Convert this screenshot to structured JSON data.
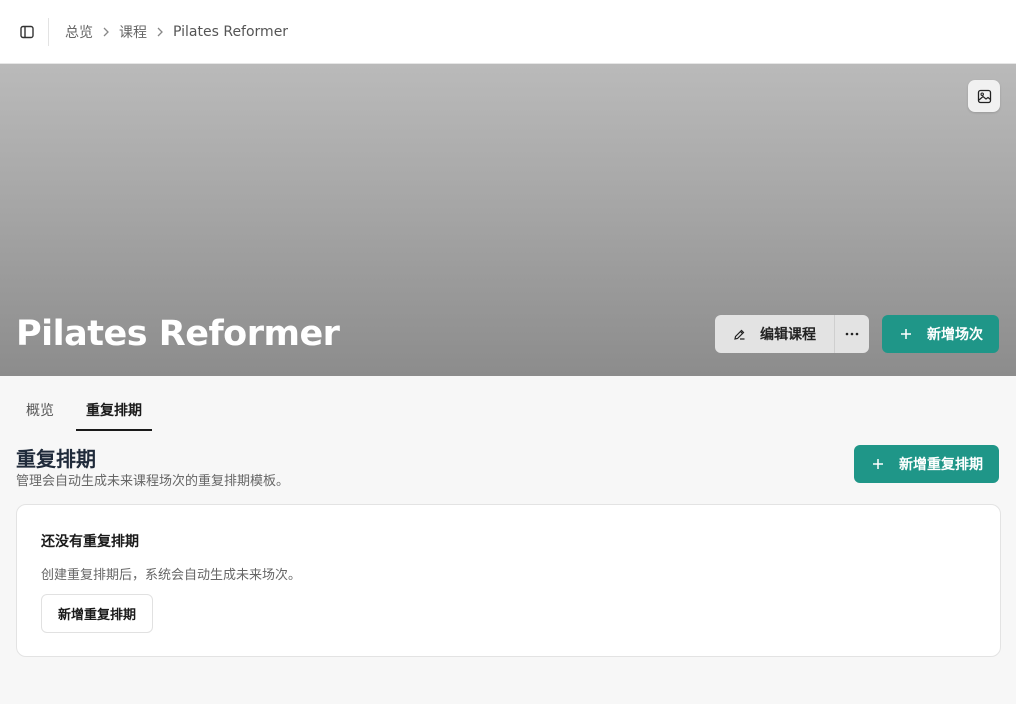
{
  "breadcrumb": {
    "items": [
      "总览",
      "课程",
      "Pilates Reformer"
    ]
  },
  "hero": {
    "title": "Pilates Reformer",
    "edit_label": "编辑课程",
    "add_session_label": "新增场次"
  },
  "tabs": [
    {
      "label": "概览",
      "active": false
    },
    {
      "label": "重复排期",
      "active": true
    }
  ],
  "section": {
    "title": "重复排期",
    "description": "管理会自动生成未来课程场次的重复排期模板。",
    "add_label": "新增重复排期"
  },
  "empty_state": {
    "title": "还没有重复排期",
    "description": "创建重复排期后，系统会自动生成未来场次。",
    "button_label": "新增重复排期"
  },
  "colors": {
    "accent": "#1f9688",
    "hero_top": "#bababa",
    "hero_bottom": "#8c8c8c"
  },
  "icons": {
    "sidebar_toggle": "sidebar-toggle-icon",
    "hero_image": "image-icon",
    "edit": "pencil-icon",
    "more": "more-horizontal-icon",
    "add": "plus-icon"
  }
}
